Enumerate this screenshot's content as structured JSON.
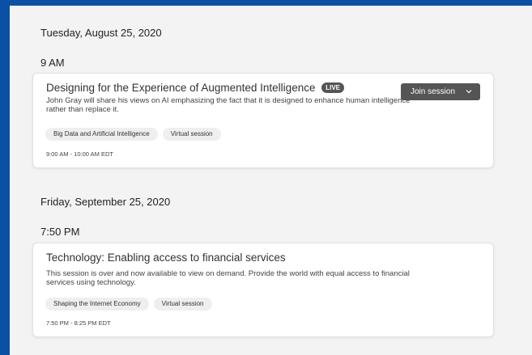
{
  "sessions_day1": {
    "date": "Tuesday, August 25, 2020",
    "time": "9 AM",
    "card": {
      "title": "Designing for the Experience of Augmented Intelligence",
      "badge": "LIVE",
      "description": "John Gray will share his views on AI emphasizing the fact that it is designed to enhance human intelligence rather than replace it.",
      "tags": [
        "Big Data and Artificial Intelligence",
        "Virtual session"
      ],
      "time_range": "9:00 AM - 10:00 AM EDT",
      "join_label": "Join session"
    }
  },
  "sessions_day2": {
    "date": "Friday, September 25, 2020",
    "time": "7:50 PM",
    "card": {
      "title": "Technology: Enabling access to financial services",
      "description": "This session is over and now available to view on demand. Provide the world with equal access to financial services using technology.",
      "tags": [
        "Shaping the Internet Economy",
        "Virtual session"
      ],
      "time_range": "7:50 PM - 8:25 PM EDT"
    }
  },
  "icons": {
    "join_dropdown": "chevron-down-icon"
  },
  "colors": {
    "frame_border": "#0a51a6",
    "button_bg": "#555555",
    "page_bg": "#f3f3f3"
  }
}
